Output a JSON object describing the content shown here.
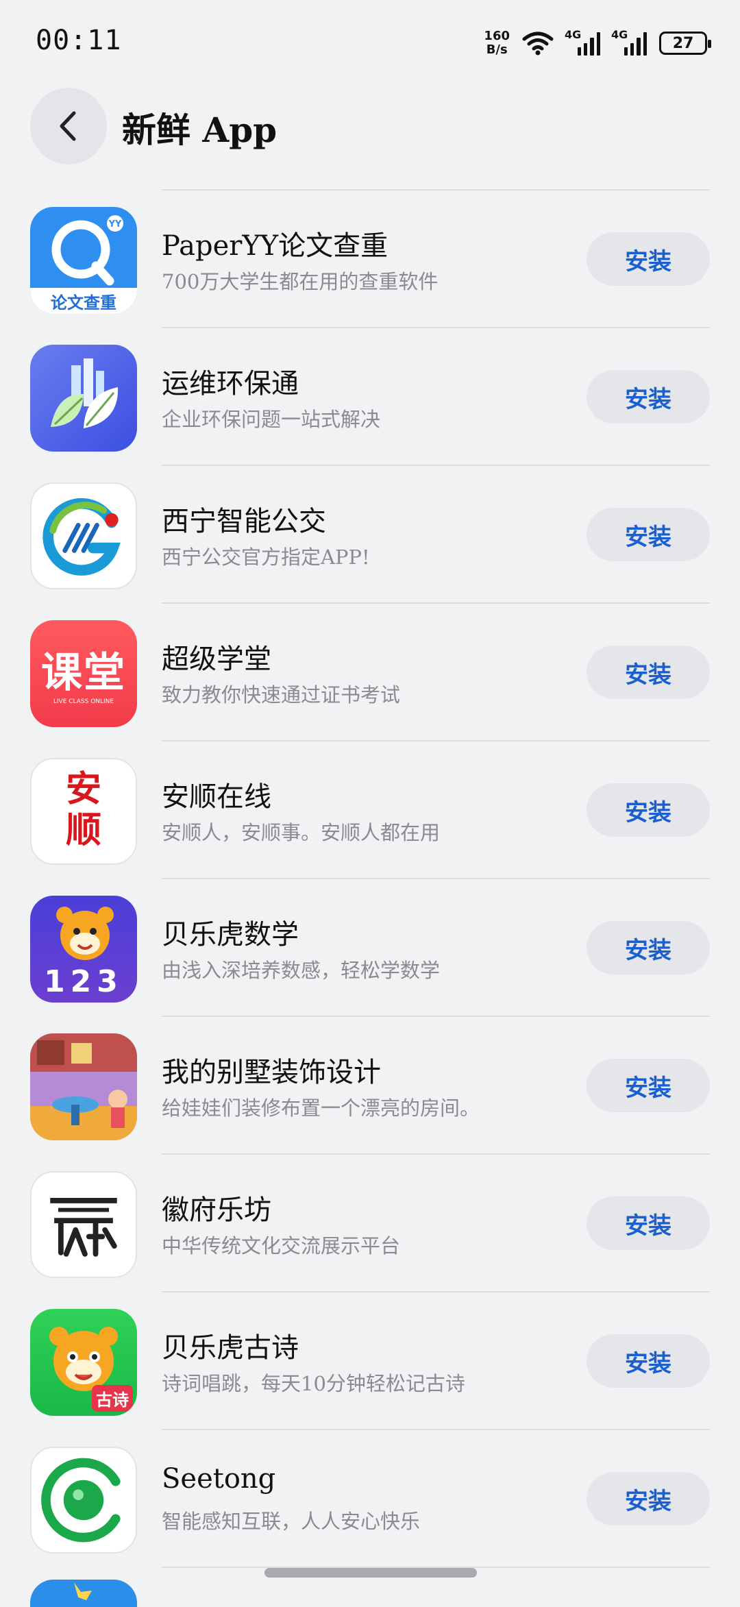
{
  "status_bar": {
    "time": "00:11",
    "net_speed_value": "160",
    "net_speed_unit": "B/s",
    "signal1_label": "4G",
    "signal2_label": "4G",
    "battery": "27"
  },
  "header": {
    "title": "新鲜 App"
  },
  "install_label": "安装",
  "apps": [
    {
      "name": "PaperYY论文查重",
      "desc": "700万大学生都在用的查重软件",
      "icon": "paperyy-icon",
      "icon_text": "论文查重"
    },
    {
      "name": "运维环保通",
      "desc": "企业环保问题一站式解决",
      "icon": "leaf-city-icon"
    },
    {
      "name": "西宁智能公交",
      "desc": "西宁公交官方指定APP!",
      "icon": "xining-bus-icon"
    },
    {
      "name": "超级学堂",
      "desc": "致力教你快速通过证书考试",
      "icon": "ketang-icon",
      "icon_text": "课堂",
      "icon_subtext": "LIVE CLASS ONLINE"
    },
    {
      "name": "安顺在线",
      "desc": "安顺人，安顺事。安顺人都在用",
      "icon": "anshun-icon",
      "icon_text": "安顺"
    },
    {
      "name": "贝乐虎数学",
      "desc": "由浅入深培养数感，轻松学数学",
      "icon": "tiger-math-icon",
      "icon_text": "123"
    },
    {
      "name": "我的别墅装饰设计",
      "desc": "给娃娃们装修布置一个漂亮的房间。",
      "icon": "villa-room-icon"
    },
    {
      "name": "徽府乐坊",
      "desc": "中华传统文化交流展示平台",
      "icon": "huifu-icon"
    },
    {
      "name": "贝乐虎古诗",
      "desc": "诗词唱跳，每天10分钟轻松记古诗",
      "icon": "tiger-poem-icon",
      "icon_text": "古诗"
    },
    {
      "name": "Seetong",
      "desc": "智能感知互联，人人安心快乐",
      "icon": "seetong-icon"
    }
  ]
}
